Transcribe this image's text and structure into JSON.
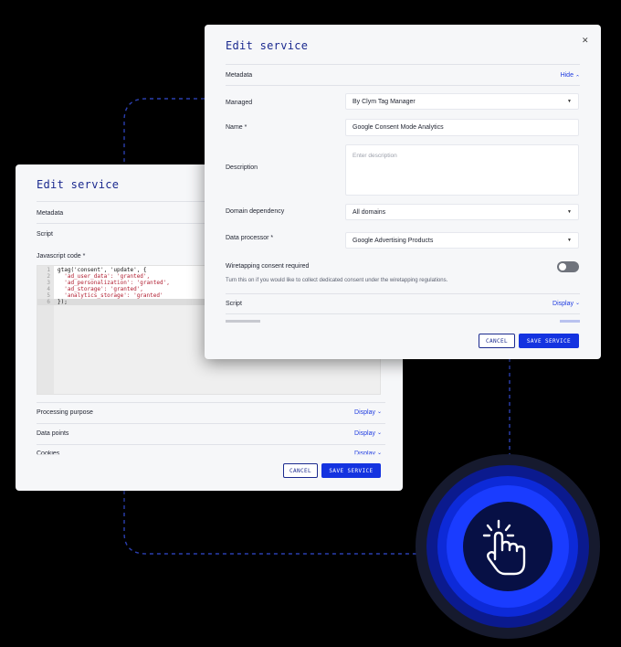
{
  "colors": {
    "accent": "#1433e0",
    "title": "#1b2a8f",
    "background": "#000000",
    "panel": "#f6f7f9"
  },
  "back_modal": {
    "title": "Edit service",
    "metadata_label": "Metadata",
    "script_label": "Script",
    "js_code_label": "Javascript code *",
    "code_lines": [
      {
        "n": "1",
        "text": "gtag('consent', 'update', {"
      },
      {
        "n": "2",
        "text": "  'ad_user_data': 'granted',"
      },
      {
        "n": "3",
        "text": "  'ad_personalization': 'granted',"
      },
      {
        "n": "4",
        "text": "  'ad_storage': 'granted',"
      },
      {
        "n": "5",
        "text": "  'analytics_storage': 'granted'"
      },
      {
        "n": "6",
        "text": "});"
      }
    ],
    "processing_purpose_label": "Processing purpose",
    "data_points_label": "Data points",
    "cookies_label": "Cookies",
    "display_label": "Display",
    "cancel_label": "CANCEL",
    "save_label": "SAVE SERVICE"
  },
  "front_modal": {
    "title": "Edit service",
    "close_icon": "close-icon",
    "metadata_label": "Metadata",
    "hide_label": "Hide",
    "managed_label": "Managed",
    "managed_value": "By Clym Tag Manager",
    "name_label": "Name *",
    "name_value": "Google Consent Mode Analytics",
    "description_label": "Description",
    "description_placeholder": "Enter description",
    "domain_dependency_label": "Domain dependency",
    "domain_dependency_value": "All domains",
    "data_processor_label": "Data processor *",
    "data_processor_value": "Google Advertising Products",
    "wiretapping_label": "Wiretapping consent required",
    "wiretapping_help": "Turn this on if you would like to collect dedicated consent under the wiretapping regulations.",
    "wiretapping_on": false,
    "script_label": "Script",
    "display_label": "Display",
    "cancel_label": "CANCEL",
    "save_label": "SAVE SERVICE"
  },
  "click_badge": {
    "icon": "hand-pointer-click-icon"
  }
}
